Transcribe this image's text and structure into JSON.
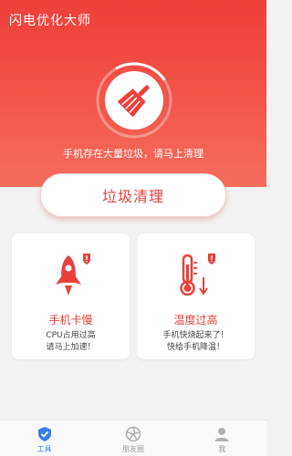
{
  "app": {
    "title": "闪电优化大师"
  },
  "hero": {
    "message": "手机存在大量垃圾，请马上清理"
  },
  "clean_button": {
    "label": "垃圾清理"
  },
  "cards": [
    {
      "title": "手机卡慢",
      "lines": [
        "CPU占用过高",
        "请马上加速！"
      ]
    },
    {
      "title": "温度过高",
      "lines": [
        "手机快烧起来了！",
        "快给手机降温！"
      ]
    }
  ],
  "tabs": [
    {
      "label": "工具",
      "active": true
    },
    {
      "label": "朋友圈",
      "active": false
    },
    {
      "label": "我",
      "active": false
    }
  ],
  "colors": {
    "accent": "#e8403a",
    "tab_active": "#3a7ee8",
    "hero_top": "#ef3f3a"
  }
}
